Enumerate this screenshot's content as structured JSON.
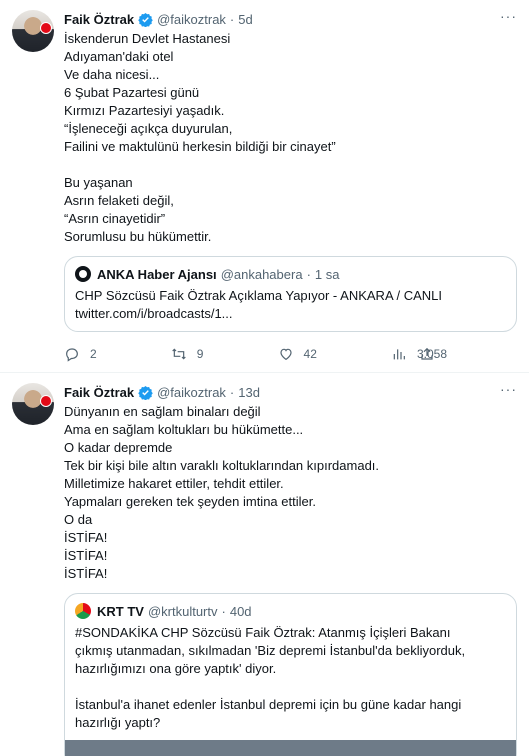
{
  "tweets": [
    {
      "author": "Faik Öztrak",
      "handle": "@faikoztrak",
      "time": "5d",
      "lines": [
        "İskenderun Devlet Hastanesi",
        "Adıyaman'daki otel",
        "Ve daha nicesi...",
        "6 Şubat Pazartesi günü",
        "Kırmızı Pazartesiyi yaşadık.",
        "“İşleneceği açıkça duyurulan,",
        "Failini ve maktulünü herkesin bildiği bir cinayet”",
        "",
        "Bu yaşanan",
        "Asrın felaketi değil,",
        "“Asrın cinayetidir”",
        "Sorumlusu bu hükümettir."
      ],
      "quote": {
        "name": "ANKA Haber Ajansı",
        "handle": "@ankahabera",
        "time": "1 sa",
        "lines": [
          "CHP Sözcüsü Faik Öztrak Açıklama Yapıyor - ANKARA / CANLI",
          "twitter.com/i/broadcasts/1..."
        ]
      },
      "stats": {
        "replies": "2",
        "retweets": "9",
        "likes": "42",
        "views": "3.058"
      }
    },
    {
      "author": "Faik Öztrak",
      "handle": "@faikoztrak",
      "time": "13d",
      "lines": [
        "Dünyanın en sağlam binaları değil",
        "Ama en sağlam koltukları bu hükümette...",
        "O kadar depremde",
        "Tek bir kişi bile altın varaklı koltuklarından kıpırdamadı.",
        "Milletimize hakaret ettiler, tehdit ettiler.",
        "Yapmaları gereken tek şeyden imtina ettiler.",
        "O da",
        "İSTİFA!",
        "İSTİFA!",
        "İSTİFA!"
      ],
      "quote": {
        "name": "KRT TV",
        "handle": "@krtkulturtv",
        "time": "40d",
        "lines": [
          "#SONDAKİKA CHP Sözcüsü Faik Öztrak: Atanmış İçişleri Bakanı",
          "çıkmış utanmadan, sıkılmadan 'Biz depremi İstanbul'da bekliyorduk,",
          "hazırlığımızı ona göre yaptık' diyor.",
          "",
          "İstanbul'a ihanet edenler İstanbul depremi için bu güne kadar hangi",
          "hazırlığı yaptı?"
        ]
      }
    }
  ],
  "more_label": "···",
  "dot": "·",
  "icons": [
    "verified-badge-icon",
    "reply-icon",
    "retweet-icon",
    "like-icon",
    "views-icon",
    "share-icon",
    "more-icon"
  ],
  "colors": {
    "verified": "#1d9bf0",
    "muted": "#536471",
    "border": "#cfd9de"
  }
}
